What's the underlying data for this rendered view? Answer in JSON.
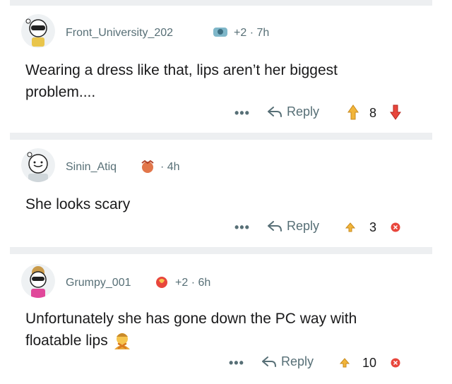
{
  "comments": [
    {
      "username": "Front_University_202",
      "extra": "+2 · 7h",
      "body_lines": [
        "Wearing a dress like that, lips aren’t her biggest",
        "problem...."
      ],
      "more": "•••",
      "reply_label": "Reply",
      "score": "8"
    },
    {
      "username": "Sinin_Atiq",
      "extra": "· 4h",
      "body_lines": [
        "She looks scary"
      ],
      "more": "•••",
      "reply_label": "Reply",
      "score": "3"
    },
    {
      "username": "Grumpy_001",
      "extra": "+2 · 6h",
      "body_lines": [
        "Unfortunately she has gone down the PC way with",
        "floatable lips"
      ],
      "more": "•••",
      "reply_label": "Reply",
      "score": "10"
    }
  ],
  "icons": {
    "upvote": "upvote-icon",
    "downvote": "downvote-icon",
    "reply": "reply-arrow-icon",
    "emoji": "person-gesturing-no-emoji"
  },
  "colors": {
    "upvote": "#f2b53a",
    "downvote": "#e8463c",
    "muted": "#576f76",
    "divider": "#edeff1"
  }
}
